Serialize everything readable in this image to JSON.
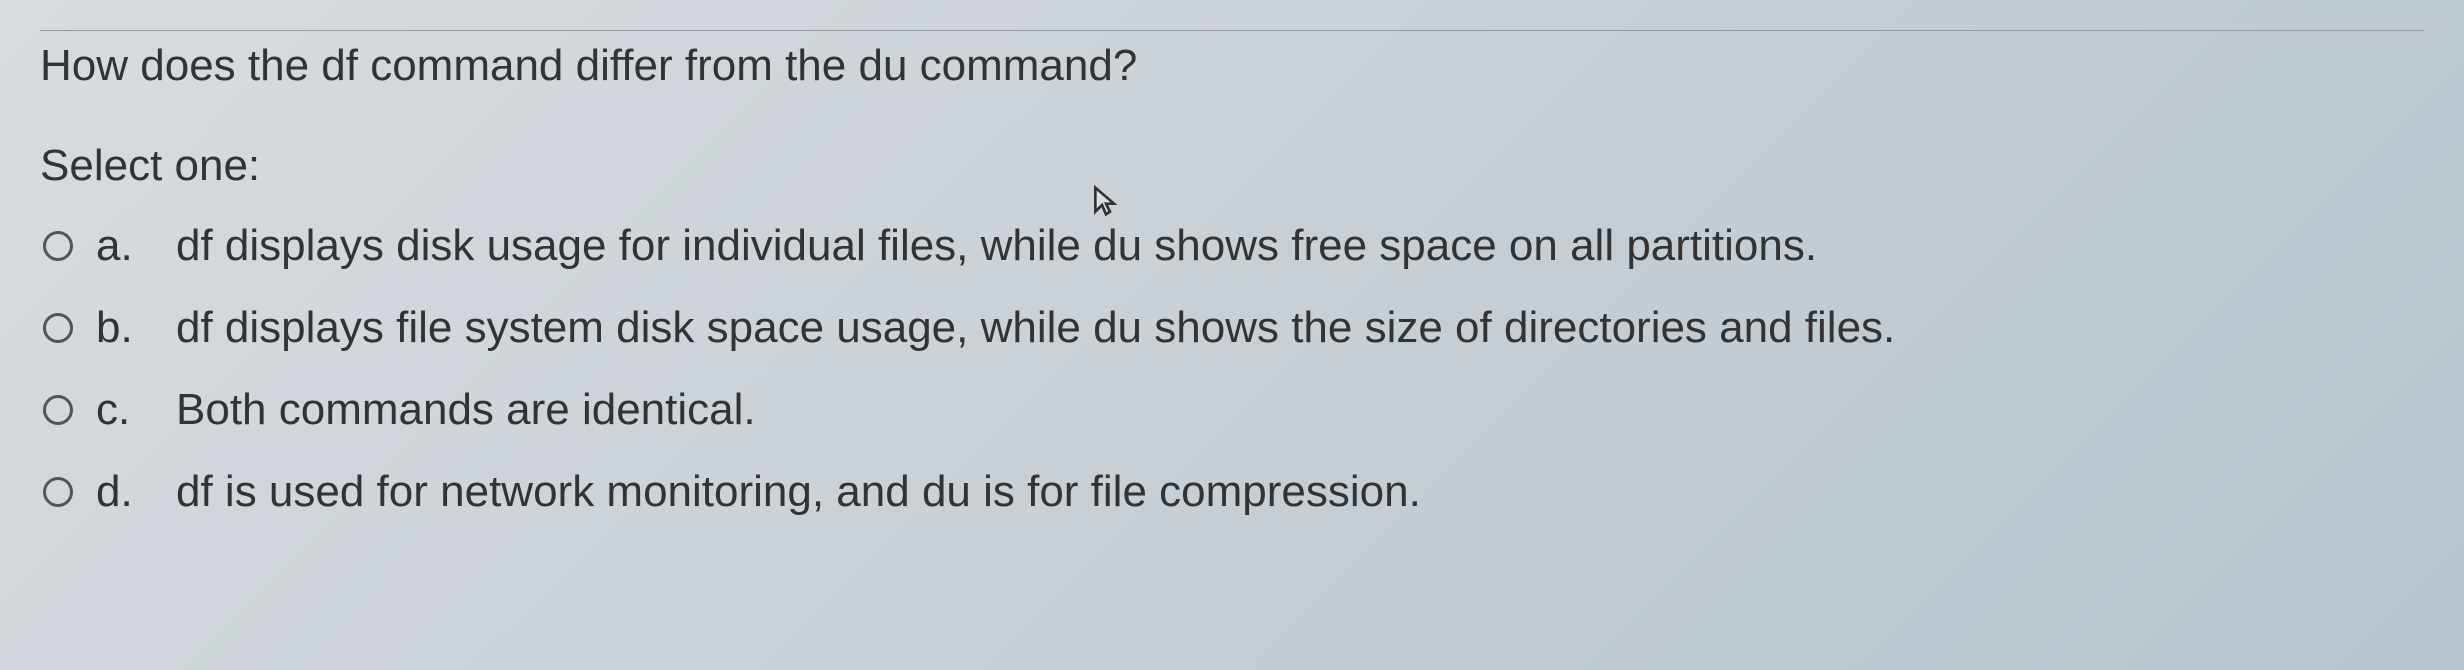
{
  "question": {
    "text": "How does the df command differ from the du command?",
    "prompt": "Select one:"
  },
  "options": [
    {
      "letter": "a.",
      "text": "df displays disk usage for individual files, while du shows free space on all partitions."
    },
    {
      "letter": "b.",
      "text": "df displays file system disk space usage, while du shows the size of directories and files."
    },
    {
      "letter": "c.",
      "text": "Both commands are identical."
    },
    {
      "letter": "d.",
      "text": "df is used for network monitoring, and du is for file compression."
    }
  ]
}
